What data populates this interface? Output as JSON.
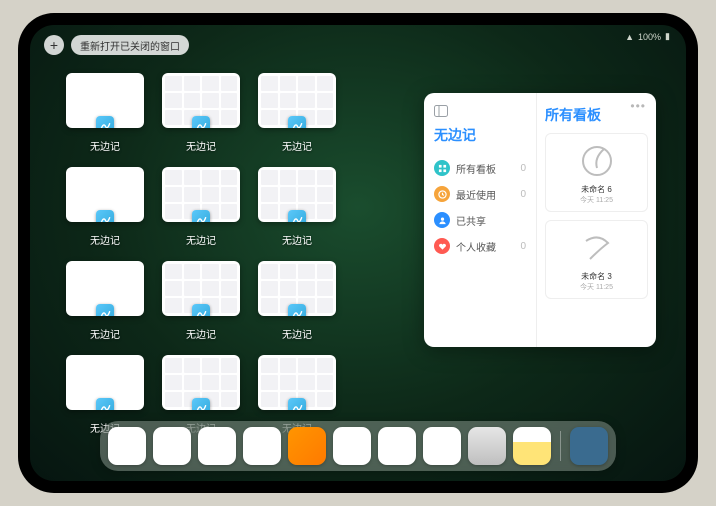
{
  "status": {
    "signal": "􀙇",
    "battery": "100%"
  },
  "top": {
    "plus": "+",
    "reopen": "重新打开已关闭的窗口"
  },
  "windows": [
    {
      "label": "无边记",
      "variant": "blank"
    },
    {
      "label": "无边记",
      "variant": "cal"
    },
    {
      "label": "无边记",
      "variant": "cal"
    },
    {
      "label": "无边记",
      "variant": "blank"
    },
    {
      "label": "无边记",
      "variant": "cal"
    },
    {
      "label": "无边记",
      "variant": "cal"
    },
    {
      "label": "无边记",
      "variant": "blank"
    },
    {
      "label": "无边记",
      "variant": "cal"
    },
    {
      "label": "无边记",
      "variant": "cal"
    },
    {
      "label": "无边记",
      "variant": "blank"
    },
    {
      "label": "无边记",
      "variant": "cal"
    },
    {
      "label": "无边记",
      "variant": "cal"
    }
  ],
  "panel": {
    "title": "无边记",
    "menu": "•••",
    "items": [
      {
        "icon": "grid",
        "color": "#2fc3c9",
        "label": "所有看板",
        "count": "0"
      },
      {
        "icon": "clock",
        "color": "#f6a43b",
        "label": "最近使用",
        "count": "0"
      },
      {
        "icon": "person",
        "color": "#2b8fff",
        "label": "已共享"
      },
      {
        "icon": "heart",
        "color": "#ff5a52",
        "label": "个人收藏",
        "count": "0"
      }
    ],
    "right_title": "所有看板",
    "cards": [
      {
        "name": "未命名 6",
        "time": "今天 11:25",
        "digit": "6"
      },
      {
        "name": "未命名 3",
        "time": "今天 11:25",
        "digit": "3"
      }
    ]
  },
  "dock": [
    {
      "name": "wechat",
      "bg": "#fff"
    },
    {
      "name": "quark",
      "bg": "#fff"
    },
    {
      "name": "qqbrowser",
      "bg": "#fff"
    },
    {
      "name": "play",
      "bg": "#fff"
    },
    {
      "name": "books",
      "bg": "linear-gradient(135deg,#ff9500,#ff7a00)"
    },
    {
      "name": "dice",
      "bg": "#fff"
    },
    {
      "name": "nodes",
      "bg": "#fff"
    },
    {
      "name": "freeform",
      "bg": "#fff"
    },
    {
      "name": "settings",
      "bg": "linear-gradient(#e6e6e6,#bfbfbf)"
    },
    {
      "name": "notes",
      "bg": "linear-gradient(#fff 40%,#ffe477 40%)"
    },
    {
      "name": "applib",
      "bg": "#3a6b8f",
      "sep_before": true
    }
  ]
}
